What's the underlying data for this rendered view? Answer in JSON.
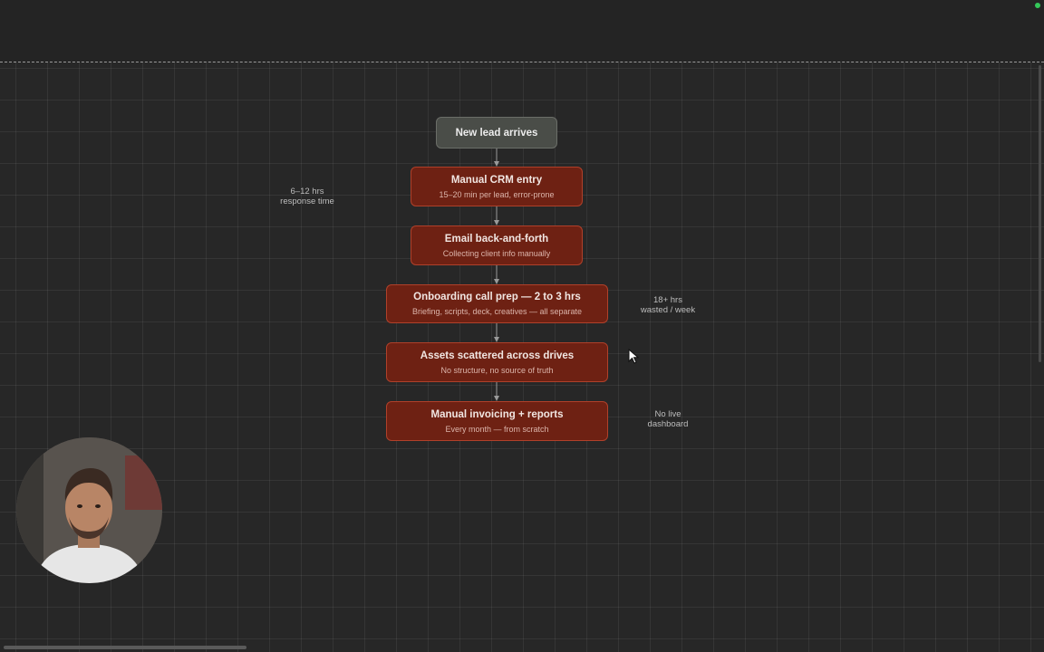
{
  "diagram": {
    "nodes": [
      {
        "id": "n1",
        "title": "New lead arrives",
        "subtitle": "",
        "kind": "neutral"
      },
      {
        "id": "n2",
        "title": "Manual CRM entry",
        "subtitle": "15–20 min per lead, error-prone",
        "kind": "problem"
      },
      {
        "id": "n3",
        "title": "Email back-and-forth",
        "subtitle": "Collecting client info manually",
        "kind": "problem"
      },
      {
        "id": "n4",
        "title": "Onboarding call prep — 2 to 3 hrs",
        "subtitle": "Briefing, scripts, deck, creatives — all separate",
        "kind": "problem"
      },
      {
        "id": "n5",
        "title": "Assets scattered across drives",
        "subtitle": "No structure, no source of truth",
        "kind": "problem"
      },
      {
        "id": "n6",
        "title": "Manual invoicing + reports",
        "subtitle": "Every month — from scratch",
        "kind": "problem"
      }
    ],
    "edges": [
      {
        "from": "n1",
        "to": "n2"
      },
      {
        "from": "n2",
        "to": "n3"
      },
      {
        "from": "n3",
        "to": "n4"
      },
      {
        "from": "n4",
        "to": "n5"
      },
      {
        "from": "n5",
        "to": "n6"
      }
    ],
    "annotations": {
      "response_time": {
        "line1": "6–12 hrs",
        "line2": "response time"
      },
      "wasted": {
        "line1": "18+ hrs",
        "line2": "wasted / week"
      },
      "dashboard": {
        "line1": "No live",
        "line2": "dashboard"
      }
    },
    "colors": {
      "neutral_fill": "#4a4d48",
      "problem_fill": "#6e2113",
      "problem_border": "#b0402a",
      "connector": "#9a9a9a",
      "background": "#272727"
    }
  },
  "icons": {
    "cursor": "mouse-pointer-icon",
    "webcam": "presenter-webcam"
  }
}
